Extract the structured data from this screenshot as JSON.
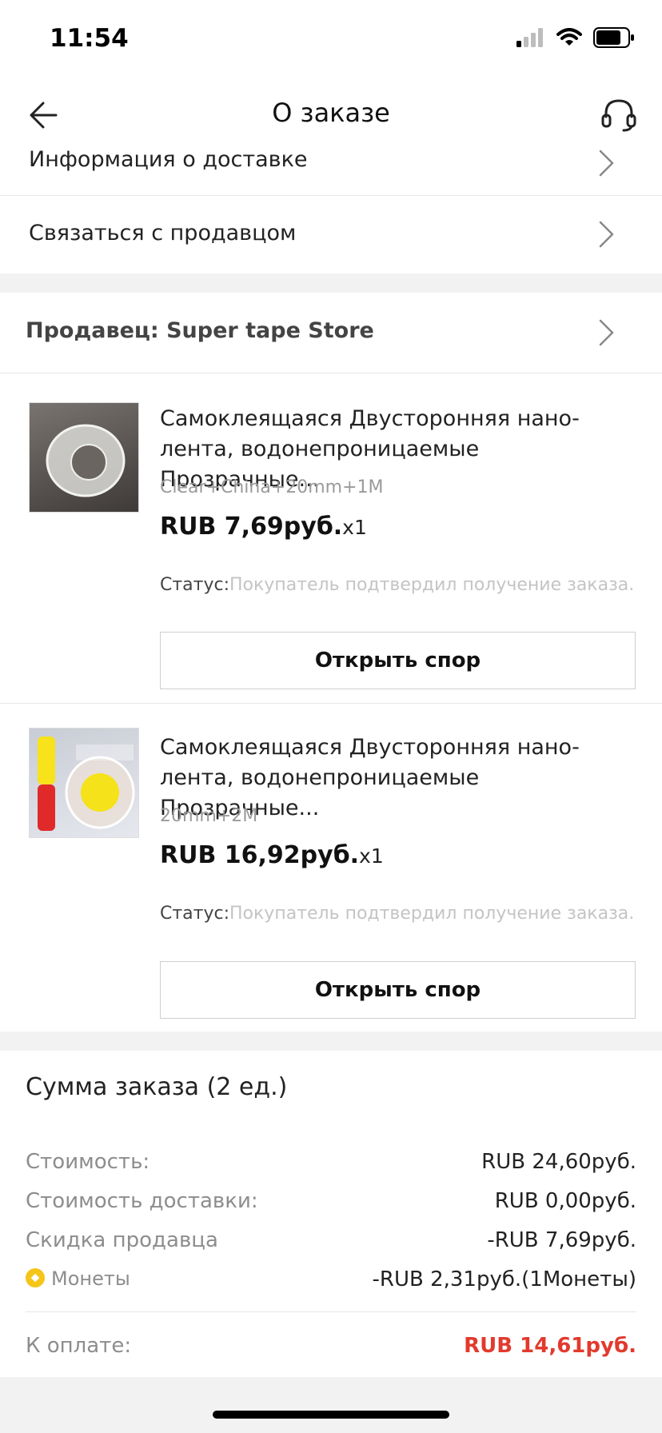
{
  "status_bar": {
    "time": "11:54"
  },
  "header": {
    "title": "О заказе",
    "back_icon": "arrow-left-icon",
    "support_icon": "headset-icon"
  },
  "links": [
    {
      "label": "Информация о доставке"
    },
    {
      "label": "Связаться с продавцом"
    }
  ],
  "seller": {
    "label": "Продавец: Super tape Store"
  },
  "products": [
    {
      "title": "Самоклеящаяся Двусторонняя нано-лента, водонепроницаемые Прозрачные...",
      "variant": "Clear+China+20mm+1M",
      "price": "RUB 7,69руб.",
      "qty": "x1",
      "status_label": "Статус:",
      "status_value": "Покупатель подтвердил получение заказа.",
      "button": "Открыть спор"
    },
    {
      "title": "Самоклеящаяся Двусторонняя нано-лента, водонепроницаемые Прозрачные...",
      "variant": "20mm+2M",
      "price": "RUB 16,92руб.",
      "qty": "x1",
      "status_label": "Статус:",
      "status_value": "Покупатель подтвердил получение заказа.",
      "button": "Открыть спор"
    }
  ],
  "summary": {
    "title": "Сумма заказа (2 ед.)",
    "rows": [
      {
        "label": "Стоимость:",
        "value": "RUB 24,60руб."
      },
      {
        "label": "Стоимость доставки:",
        "value": "RUB 0,00руб."
      },
      {
        "label": "Скидка продавца",
        "value": "-RUB 7,69руб."
      },
      {
        "label": "Монеты",
        "value": "-RUB 2,31руб.(1Монеты)"
      }
    ],
    "total_label": "К оплате:",
    "total_value": "RUB 14,61руб."
  },
  "colors": {
    "accent_red": "#e23a2e",
    "coin_yellow": "#f5c518"
  }
}
